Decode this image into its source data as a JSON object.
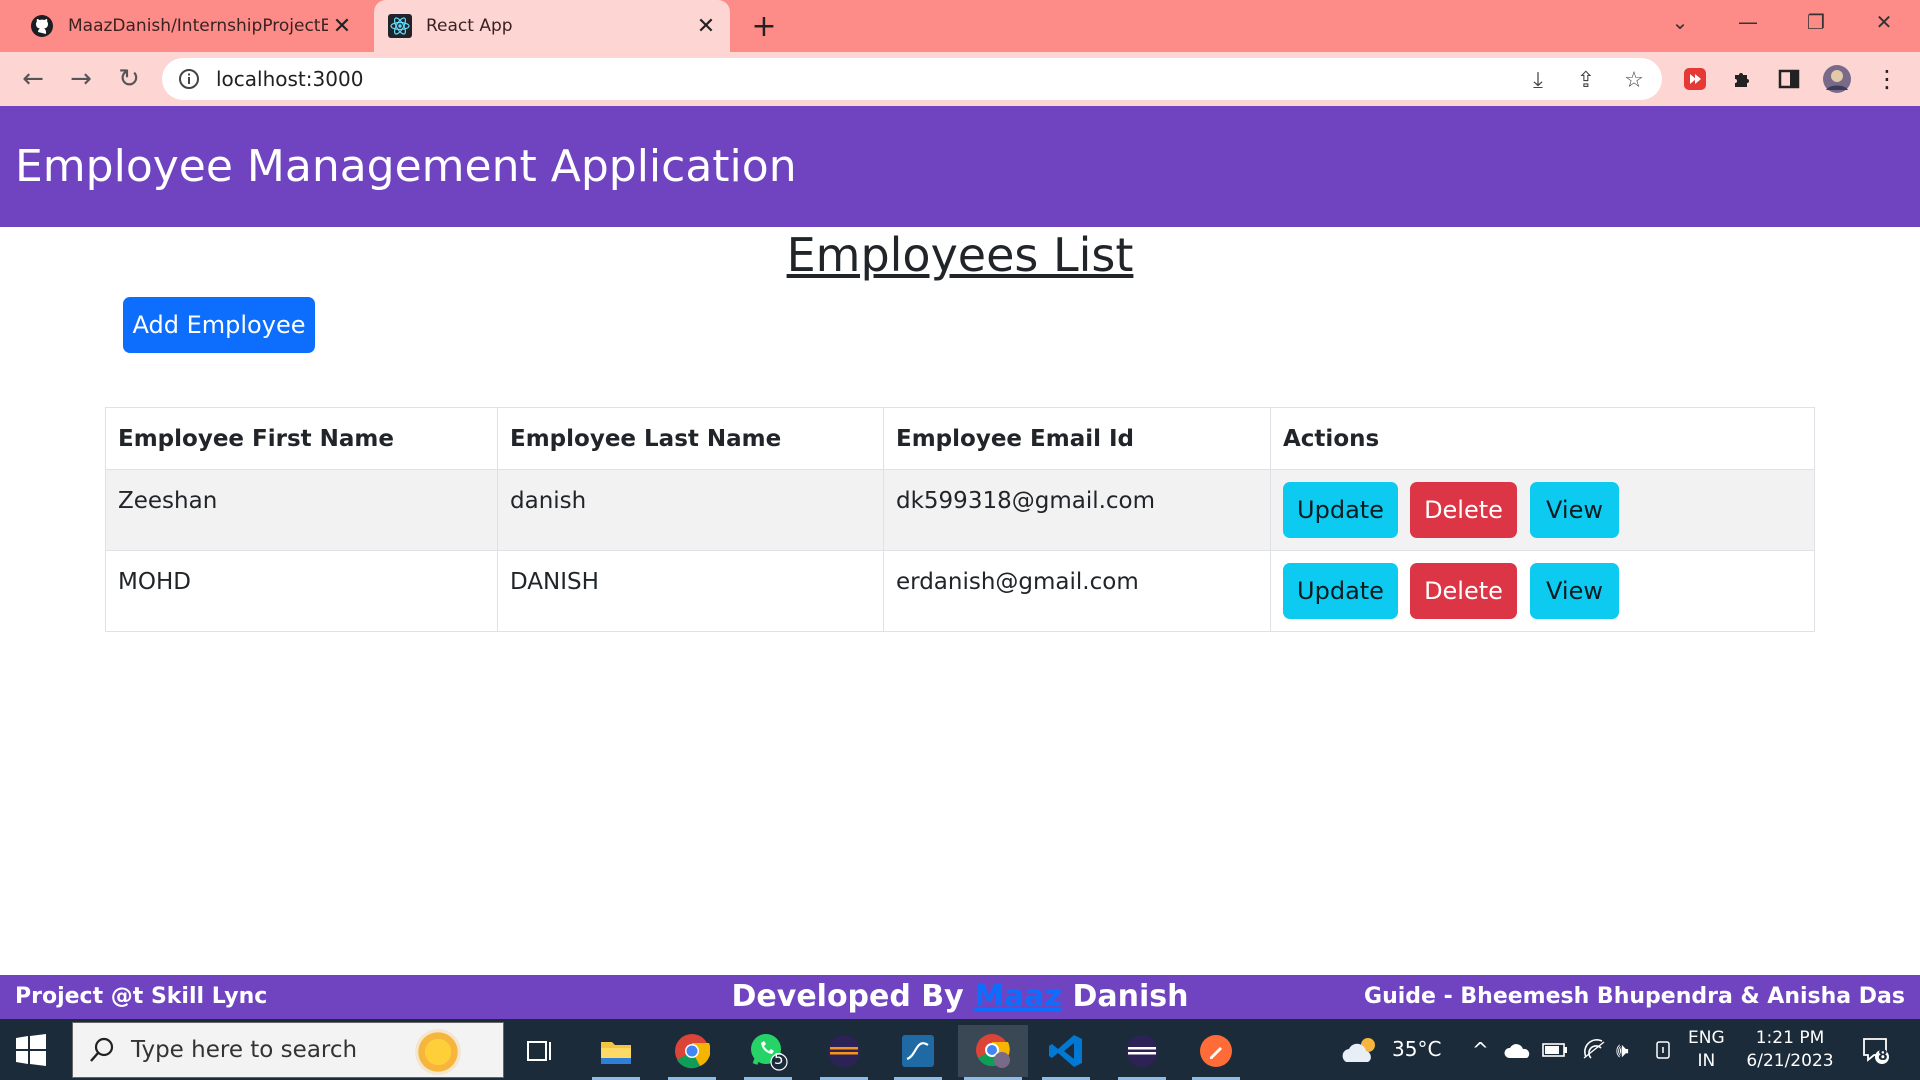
{
  "browser": {
    "tabs": [
      {
        "title": "MaazDanish/InternshipProjectEM",
        "active": false
      },
      {
        "title": "React App",
        "active": true
      }
    ],
    "url": "localhost:3000"
  },
  "app": {
    "title": "Employee Management Application",
    "heading": "Employees List",
    "add_button": "Add Employee",
    "table": {
      "headers": [
        "Employee First Name",
        "Employee Last Name",
        "Employee Email Id",
        "Actions"
      ],
      "rows": [
        {
          "first": "Zeeshan",
          "last": "danish",
          "email": "dk599318@gmail.com"
        },
        {
          "first": "MOHD",
          "last": "DANISH",
          "email": "erdanish@gmail.com"
        }
      ],
      "action_labels": {
        "update": "Update",
        "delete": "Delete",
        "view": "View"
      }
    },
    "footer": {
      "left": "Project @t Skill Lync",
      "center_prefix": "Developed By",
      "center_link": "Maaz",
      "center_suffix": "Danish",
      "right": "Guide - Bheemesh Bhupendra & Anisha Das"
    }
  },
  "taskbar": {
    "search_placeholder": "Type here to search",
    "whatsapp_badge": "5",
    "weather": "35°C",
    "language_line1": "ENG",
    "language_line2": "IN",
    "time": "1:21 PM",
    "date": "6/21/2023",
    "notification_count": "8"
  },
  "colors": {
    "app_purple": "#7043c1",
    "tab_strip": "#fd8b88",
    "toolbar": "#fdd5d3",
    "primary": "#0d6efd",
    "info": "#0dcaf0",
    "danger": "#dc3545"
  }
}
